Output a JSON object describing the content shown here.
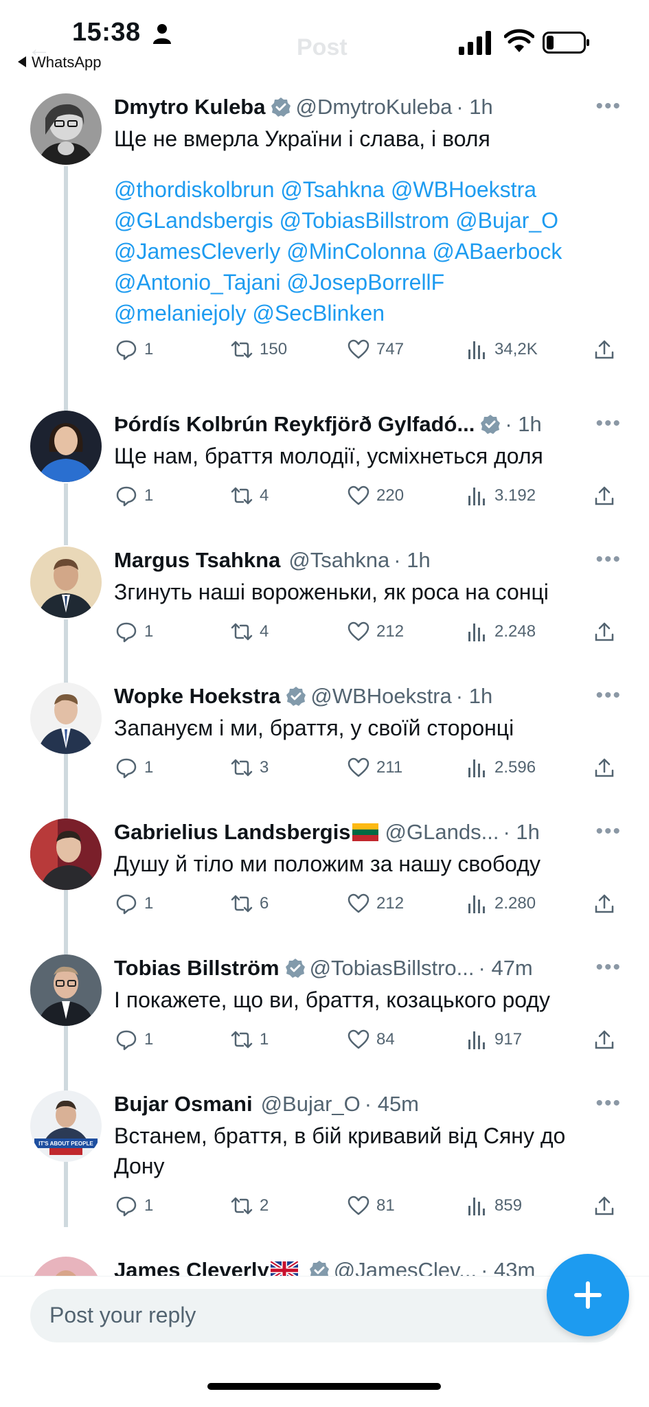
{
  "status_bar": {
    "time": "15:38",
    "back_app": "WhatsApp",
    "icons": [
      "person-icon",
      "signal-icon",
      "wifi-icon",
      "battery-icon"
    ]
  },
  "nav": {
    "title": "Post"
  },
  "colors": {
    "accent": "#1d9bf0",
    "verified": "#829aab",
    "muted": "#536471"
  },
  "posts": [
    {
      "name": "Dmytro Kuleba",
      "verified": true,
      "flag": "",
      "handle": "@DmytroKuleba",
      "time": "· 1h",
      "text": "Ще не вмерла України і слава, і воля",
      "mentions": [
        "@thordiskolbrun @Tsahkna @WBHoekstra",
        "@GLandsbergis @TobiasBillstrom @Bujar_O",
        "@JamesCleverly @MinColonna @ABaerbock",
        "@Antonio_Tajani @JosepBorrellF",
        "@melaniejoly @SecBlinken"
      ],
      "replies": "1",
      "reposts": "150",
      "likes": "747",
      "views": "34,2K"
    },
    {
      "name": "Þórdís Kolbrún Reykfjörð Gylfadó...",
      "verified": true,
      "flag": "",
      "handle": "",
      "time": "· 1h",
      "text": "Ще нам, браття молодії, усміхнеться доля",
      "replies": "1",
      "reposts": "4",
      "likes": "220",
      "views": "3.192"
    },
    {
      "name": "Margus Tsahkna",
      "verified": false,
      "flag": "",
      "handle": "@Tsahkna",
      "time": "· 1h",
      "text": "Згинуть наші вороженьки, як роса на сонці",
      "replies": "1",
      "reposts": "4",
      "likes": "212",
      "views": "2.248"
    },
    {
      "name": "Wopke Hoekstra",
      "verified": true,
      "flag": "",
      "handle": "@WBHoekstra",
      "time": "· 1h",
      "text": "Запануєм і ми, браття, у своїй сторонці",
      "replies": "1",
      "reposts": "3",
      "likes": "211",
      "views": "2.596"
    },
    {
      "name": "Gabrielius Landsbergis",
      "verified": false,
      "flag": "lithuania-flag",
      "handle": "@GLands...",
      "time": "· 1h",
      "text": "Душу й тіло ми положим за нашу свободу",
      "replies": "1",
      "reposts": "6",
      "likes": "212",
      "views": "2.280"
    },
    {
      "name": "Tobias Billström",
      "verified": true,
      "flag": "",
      "handle": "@TobiasBillstro...",
      "time": "· 47m",
      "text": "І покажете, що ви, браття, козацького роду",
      "replies": "1",
      "reposts": "1",
      "likes": "84",
      "views": "917"
    },
    {
      "name": "Bujar Osmani",
      "verified": false,
      "flag": "",
      "handle": "@Bujar_O",
      "time": "· 45m",
      "text": "Встанем, браття, в бій кривавий від Сяну до Дону",
      "replies": "1",
      "reposts": "2",
      "likes": "81",
      "views": "859"
    },
    {
      "name": "James Cleverly",
      "verified": true,
      "flag": "uk-flag",
      "handle": "@JamesClev...",
      "time": "· 43m"
    }
  ],
  "avatars": [
    {
      "badge": ""
    },
    {
      "badge": ""
    },
    {
      "badge": ""
    },
    {
      "badge": ""
    },
    {
      "badge": ""
    },
    {
      "badge": ""
    },
    {
      "badge": "IT'S ABOUT PEOPLE"
    },
    {
      "badge": ""
    }
  ],
  "reply_bar": {
    "placeholder": "Post your reply",
    "fab_icon": "plus-icon"
  }
}
